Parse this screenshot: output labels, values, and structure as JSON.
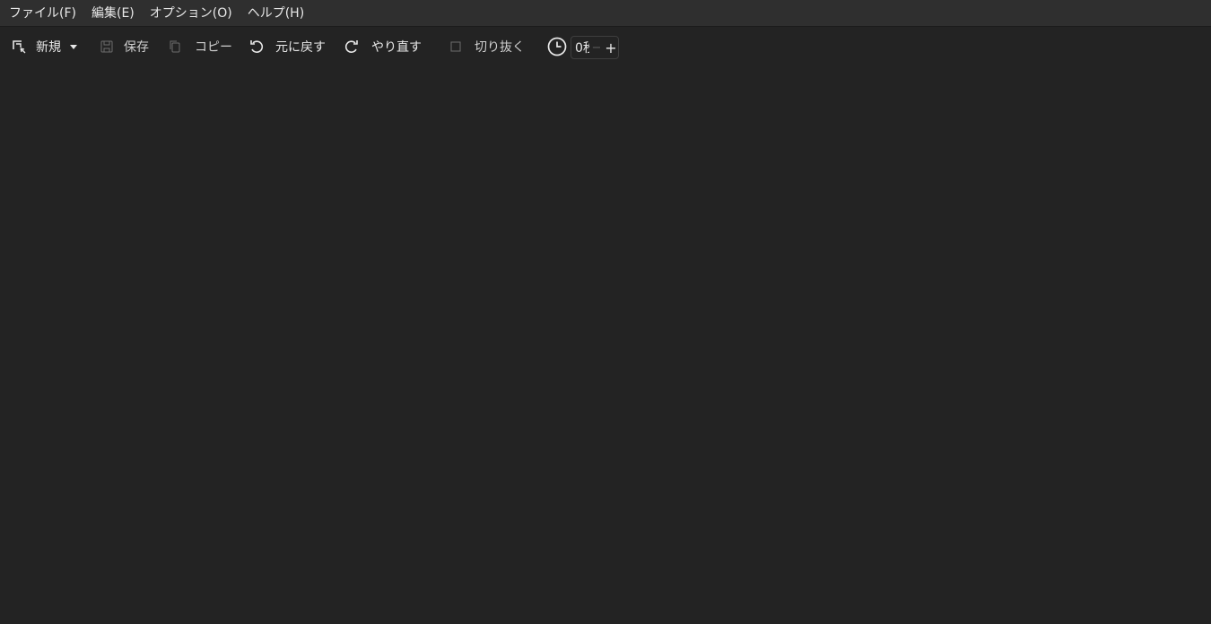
{
  "menu": {
    "file": "ファイル(F)",
    "edit": "編集(E)",
    "options": "オプション(O)",
    "help": "ヘルプ(H)"
  },
  "toolbar": {
    "new_label": "新規",
    "save_label": "保存",
    "copy_label": "コピー",
    "undo_label": "元に戻す",
    "redo_label": "やり直す",
    "crop_label": "切り抜く",
    "delay_value": "0秒",
    "delay_minus": "−",
    "delay_plus": "+"
  },
  "icons": {
    "new": "new-snip-icon",
    "dropdown": "caret-down-icon",
    "save": "save-icon",
    "copy": "copy-icon",
    "undo": "undo-icon",
    "redo": "redo-icon",
    "crop": "crop-icon",
    "delay": "clock-icon"
  },
  "colors": {
    "background": "#232323",
    "menubar": "#2f2f2f",
    "text": "#e8e8e8",
    "disabled_icon": "#6d6d6d"
  }
}
